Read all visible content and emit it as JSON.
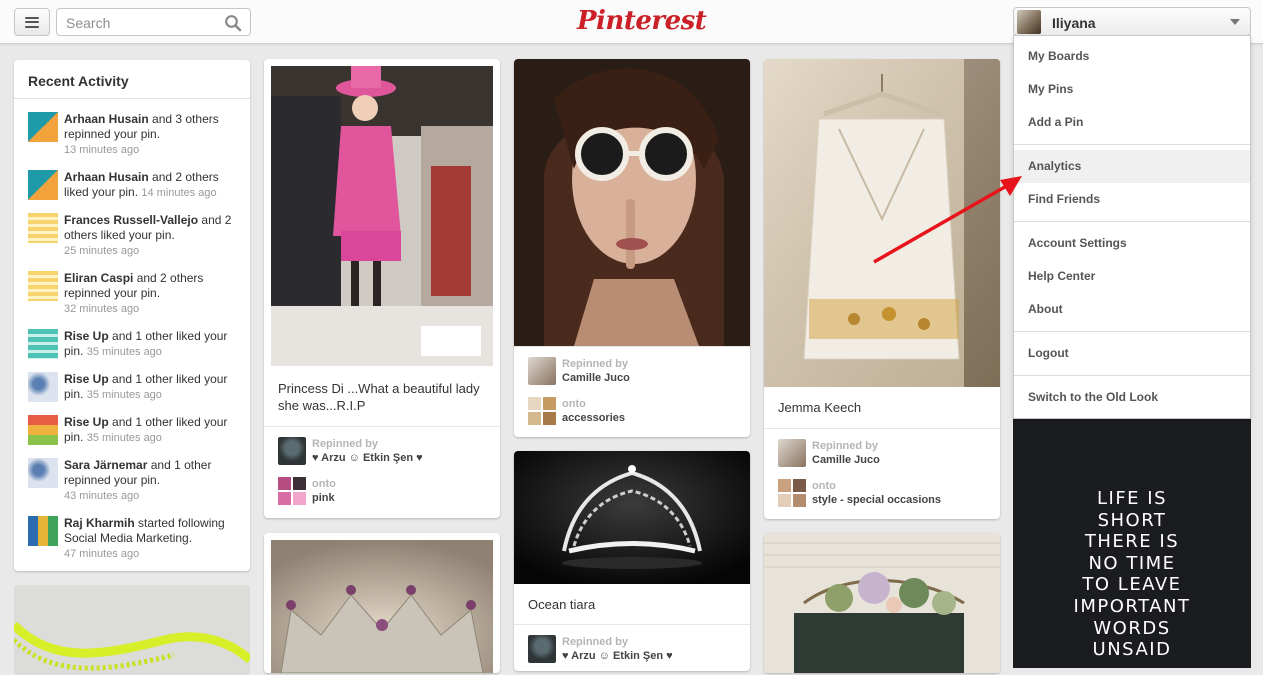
{
  "header": {
    "menu_icon": "hamburger-icon",
    "search_placeholder": "Search",
    "search_icon": "search-icon",
    "logo_text": "Pinterest",
    "logo_color": "#cb2027",
    "user_name": "Iliyana"
  },
  "dropdown": {
    "items": [
      {
        "label": "My Boards"
      },
      {
        "label": "My Pins"
      },
      {
        "label": "Add a Pin"
      },
      {
        "label": "Analytics",
        "active": true
      },
      {
        "label": "Find Friends"
      },
      {
        "label": "Account Settings"
      },
      {
        "label": "Help Center"
      },
      {
        "label": "About"
      },
      {
        "label": "Logout"
      },
      {
        "label": "Switch to the Old Look"
      }
    ]
  },
  "activity": {
    "title": "Recent Activity",
    "items": [
      {
        "who": "Arhaan Husain",
        "rest": " and 3 others repinned your pin.",
        "time": "13 minutes ago"
      },
      {
        "who": "Arhaan Husain",
        "rest": " and 2 others liked your pin.",
        "time": "14 minutes ago"
      },
      {
        "who": "Frances Russell-Vallejo",
        "rest": " and 2 others liked your pin.",
        "time": "25 minutes ago"
      },
      {
        "who": "Eliran Caspi",
        "rest": " and 2 others repinned your pin.",
        "time": "32 minutes ago"
      },
      {
        "who": "Rise Up",
        "rest": " and 1 other liked your pin.",
        "time": "35 minutes ago"
      },
      {
        "who": "Rise Up",
        "rest": " and 1 other liked your pin.",
        "time": "35 minutes ago"
      },
      {
        "who": "Rise Up",
        "rest": " and 1 other liked your pin.",
        "time": "35 minutes ago"
      },
      {
        "who": "Sara Järnemar",
        "rest": " and 1 other repinned your pin.",
        "time": "43 minutes ago"
      },
      {
        "who": "Raj Kharmih",
        "rest": " started following Social Media Marketing.",
        "time": "47 minutes ago"
      }
    ]
  },
  "pins": {
    "diana": {
      "caption": "Princess Di ...What a beautiful lady she was...R.I.P",
      "repinned_label": "Repinned by",
      "repinned_by": "♥ Arzu ☺ Etkin Şen ♥",
      "onto_label": "onto",
      "board": "pink"
    },
    "sunglasses": {
      "repinned_label": "Repinned by",
      "repinned_by": "Camille Juco",
      "onto_label": "onto",
      "board": "accessories"
    },
    "tiara": {
      "caption": "Ocean tiara",
      "repinned_label": "Repinned by",
      "repinned_by": "♥ Arzu ☺ Etkin Şen ♥"
    },
    "dress": {
      "caption": "Jemma Keech",
      "repinned_label": "Repinned by",
      "repinned_by": "Camille Juco",
      "onto_label": "onto",
      "board": "style - special occasions"
    },
    "quote": {
      "lines": [
        "LIFE IS",
        "SHORT",
        "THERE IS",
        "NO TIME",
        "TO LEAVE",
        "IMPORTANT",
        "WORDS",
        "UNSAID"
      ]
    }
  },
  "colors": {
    "annotation_arrow": "#e8141b"
  }
}
